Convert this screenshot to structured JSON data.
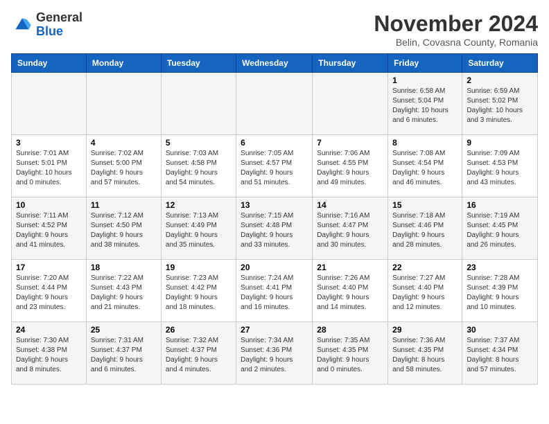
{
  "header": {
    "title": "November 2024",
    "location": "Belin, Covasna County, Romania",
    "logo_general": "General",
    "logo_blue": "Blue"
  },
  "days_of_week": [
    "Sunday",
    "Monday",
    "Tuesday",
    "Wednesday",
    "Thursday",
    "Friday",
    "Saturday"
  ],
  "weeks": [
    [
      {
        "day": "",
        "info": ""
      },
      {
        "day": "",
        "info": ""
      },
      {
        "day": "",
        "info": ""
      },
      {
        "day": "",
        "info": ""
      },
      {
        "day": "",
        "info": ""
      },
      {
        "day": "1",
        "info": "Sunrise: 6:58 AM\nSunset: 5:04 PM\nDaylight: 10 hours\nand 6 minutes."
      },
      {
        "day": "2",
        "info": "Sunrise: 6:59 AM\nSunset: 5:02 PM\nDaylight: 10 hours\nand 3 minutes."
      }
    ],
    [
      {
        "day": "3",
        "info": "Sunrise: 7:01 AM\nSunset: 5:01 PM\nDaylight: 10 hours\nand 0 minutes."
      },
      {
        "day": "4",
        "info": "Sunrise: 7:02 AM\nSunset: 5:00 PM\nDaylight: 9 hours\nand 57 minutes."
      },
      {
        "day": "5",
        "info": "Sunrise: 7:03 AM\nSunset: 4:58 PM\nDaylight: 9 hours\nand 54 minutes."
      },
      {
        "day": "6",
        "info": "Sunrise: 7:05 AM\nSunset: 4:57 PM\nDaylight: 9 hours\nand 51 minutes."
      },
      {
        "day": "7",
        "info": "Sunrise: 7:06 AM\nSunset: 4:55 PM\nDaylight: 9 hours\nand 49 minutes."
      },
      {
        "day": "8",
        "info": "Sunrise: 7:08 AM\nSunset: 4:54 PM\nDaylight: 9 hours\nand 46 minutes."
      },
      {
        "day": "9",
        "info": "Sunrise: 7:09 AM\nSunset: 4:53 PM\nDaylight: 9 hours\nand 43 minutes."
      }
    ],
    [
      {
        "day": "10",
        "info": "Sunrise: 7:11 AM\nSunset: 4:52 PM\nDaylight: 9 hours\nand 41 minutes."
      },
      {
        "day": "11",
        "info": "Sunrise: 7:12 AM\nSunset: 4:50 PM\nDaylight: 9 hours\nand 38 minutes."
      },
      {
        "day": "12",
        "info": "Sunrise: 7:13 AM\nSunset: 4:49 PM\nDaylight: 9 hours\nand 35 minutes."
      },
      {
        "day": "13",
        "info": "Sunrise: 7:15 AM\nSunset: 4:48 PM\nDaylight: 9 hours\nand 33 minutes."
      },
      {
        "day": "14",
        "info": "Sunrise: 7:16 AM\nSunset: 4:47 PM\nDaylight: 9 hours\nand 30 minutes."
      },
      {
        "day": "15",
        "info": "Sunrise: 7:18 AM\nSunset: 4:46 PM\nDaylight: 9 hours\nand 28 minutes."
      },
      {
        "day": "16",
        "info": "Sunrise: 7:19 AM\nSunset: 4:45 PM\nDaylight: 9 hours\nand 26 minutes."
      }
    ],
    [
      {
        "day": "17",
        "info": "Sunrise: 7:20 AM\nSunset: 4:44 PM\nDaylight: 9 hours\nand 23 minutes."
      },
      {
        "day": "18",
        "info": "Sunrise: 7:22 AM\nSunset: 4:43 PM\nDaylight: 9 hours\nand 21 minutes."
      },
      {
        "day": "19",
        "info": "Sunrise: 7:23 AM\nSunset: 4:42 PM\nDaylight: 9 hours\nand 18 minutes."
      },
      {
        "day": "20",
        "info": "Sunrise: 7:24 AM\nSunset: 4:41 PM\nDaylight: 9 hours\nand 16 minutes."
      },
      {
        "day": "21",
        "info": "Sunrise: 7:26 AM\nSunset: 4:40 PM\nDaylight: 9 hours\nand 14 minutes."
      },
      {
        "day": "22",
        "info": "Sunrise: 7:27 AM\nSunset: 4:40 PM\nDaylight: 9 hours\nand 12 minutes."
      },
      {
        "day": "23",
        "info": "Sunrise: 7:28 AM\nSunset: 4:39 PM\nDaylight: 9 hours\nand 10 minutes."
      }
    ],
    [
      {
        "day": "24",
        "info": "Sunrise: 7:30 AM\nSunset: 4:38 PM\nDaylight: 9 hours\nand 8 minutes."
      },
      {
        "day": "25",
        "info": "Sunrise: 7:31 AM\nSunset: 4:37 PM\nDaylight: 9 hours\nand 6 minutes."
      },
      {
        "day": "26",
        "info": "Sunrise: 7:32 AM\nSunset: 4:37 PM\nDaylight: 9 hours\nand 4 minutes."
      },
      {
        "day": "27",
        "info": "Sunrise: 7:34 AM\nSunset: 4:36 PM\nDaylight: 9 hours\nand 2 minutes."
      },
      {
        "day": "28",
        "info": "Sunrise: 7:35 AM\nSunset: 4:35 PM\nDaylight: 9 hours\nand 0 minutes."
      },
      {
        "day": "29",
        "info": "Sunrise: 7:36 AM\nSunset: 4:35 PM\nDaylight: 8 hours\nand 58 minutes."
      },
      {
        "day": "30",
        "info": "Sunrise: 7:37 AM\nSunset: 4:34 PM\nDaylight: 8 hours\nand 57 minutes."
      }
    ]
  ]
}
